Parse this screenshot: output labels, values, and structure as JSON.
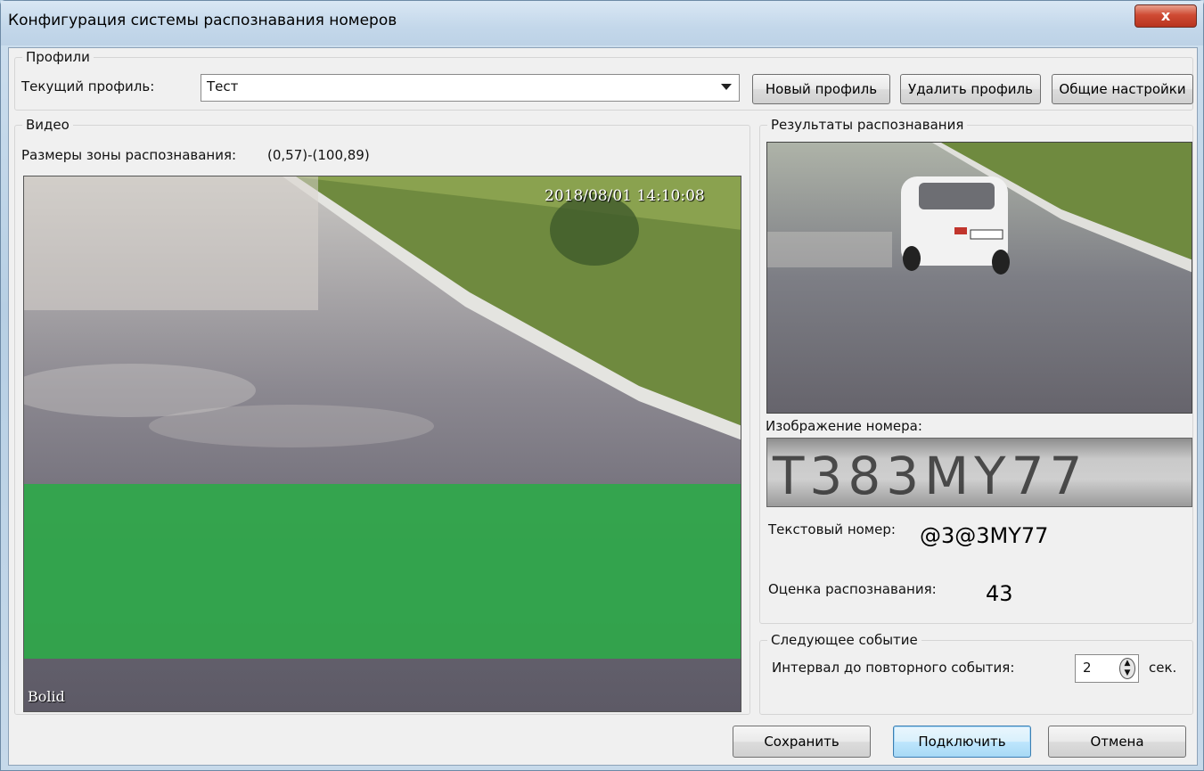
{
  "window": {
    "title": "Конфигурация системы распознавания номеров",
    "close_label": "x"
  },
  "profiles": {
    "legend": "Профили",
    "current_label": "Текущий профиль:",
    "current_value": "Тест",
    "new_button": "Новый профиль",
    "delete_button": "Удалить профиль",
    "settings_button": "Общие настройки"
  },
  "video": {
    "legend": "Видео",
    "zone_label": "Размеры зоны распознавания:",
    "zone_value": "(0,57)-(100,89)",
    "timestamp": "2018/08/01 14:10:08",
    "watermark": "Bolid",
    "zone_color": "#2fa84a"
  },
  "results": {
    "legend": "Результаты распознавания",
    "plate_image_label": "Изображение номера:",
    "plate_image_text": "T383MY77",
    "text_number_label": "Текстовый номер:",
    "text_number_value": "@3@3MY77",
    "score_label": "Оценка распознавания:",
    "score_value": "43"
  },
  "next_event": {
    "legend": "Следующее событие",
    "interval_label": "Интервал до повторного события:",
    "interval_value": "2",
    "unit": "сек."
  },
  "footer": {
    "save_button": "Сохранить",
    "connect_button": "Подключить",
    "cancel_button": "Отмена"
  }
}
